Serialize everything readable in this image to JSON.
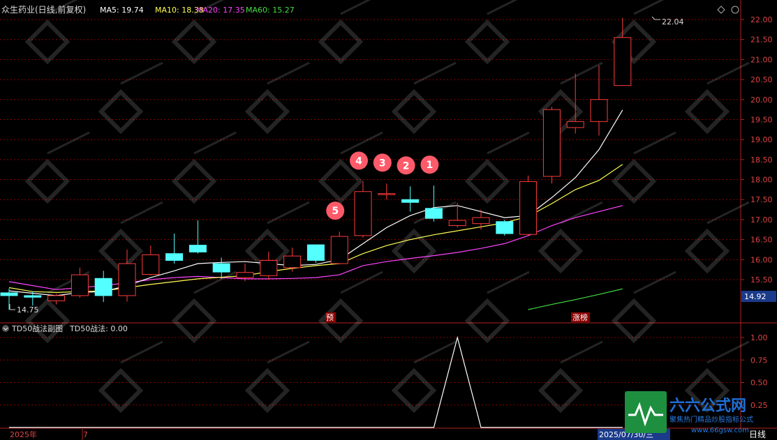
{
  "header": {
    "stock_title": "众生药业(日线,前复权)",
    "ma_items": [
      {
        "label": "MA5: 19.74",
        "color": "#ffffff"
      },
      {
        "label": "MA10: 18.38",
        "color": "#ffff55"
      },
      {
        "label": "MA20: 17.35",
        "color": "#ff44ff"
      },
      {
        "label": "MA60: 15.27",
        "color": "#44dd44"
      }
    ],
    "diamond_icon": "diamond-icon",
    "circle_icon": "circle-icon"
  },
  "price_axis": {
    "ticks": [
      "22.00",
      "21.50",
      "21.00",
      "20.50",
      "20.00",
      "19.50",
      "19.00",
      "18.50",
      "18.00",
      "17.50",
      "17.00",
      "16.50",
      "16.00",
      "15.50"
    ],
    "current_price": "14.92"
  },
  "annotations": {
    "high_label": "22.04",
    "low_label": "14.75",
    "pre_marker": "预",
    "limit_up_marker": "涨榜",
    "numbered_circles": [
      "5",
      "4",
      "3",
      "2",
      "1"
    ]
  },
  "sub_chart": {
    "title": "TD50战法副图",
    "value_label": "TD50战法: 0.00",
    "ticks": [
      "1.00",
      "0.75",
      "0.50",
      "0.25"
    ]
  },
  "bottom_bar": {
    "year_label": "2025年",
    "month_label": "7",
    "date_label": "2025/07/30/三",
    "period_label": "日线"
  },
  "watermark": {
    "brand": "六六公式网",
    "slogan": "聚焦热门精品炒股指标公式",
    "url": "www.66gsw.com"
  },
  "colors": {
    "up": "#ff3b3b",
    "down": "#54ffff",
    "ma5": "#ffffff",
    "ma10": "#ffff55",
    "ma20": "#ff44ff",
    "ma60": "#44dd44",
    "grid": "#8b0000"
  },
  "chart_data": {
    "type": "candlestick",
    "candles": [
      {
        "o": 15.17,
        "h": 15.28,
        "l": 14.75,
        "c": 15.1
      },
      {
        "o": 15.1,
        "h": 15.21,
        "l": 14.85,
        "c": 15.06
      },
      {
        "o": 14.97,
        "h": 15.15,
        "l": 14.88,
        "c": 15.1
      },
      {
        "o": 15.1,
        "h": 15.8,
        "l": 15.05,
        "c": 15.62
      },
      {
        "o": 15.53,
        "h": 15.72,
        "l": 14.94,
        "c": 15.1
      },
      {
        "o": 15.1,
        "h": 16.25,
        "l": 14.95,
        "c": 15.9
      },
      {
        "o": 15.63,
        "h": 16.35,
        "l": 15.6,
        "c": 16.12
      },
      {
        "o": 16.15,
        "h": 16.65,
        "l": 15.9,
        "c": 15.98
      },
      {
        "o": 16.36,
        "h": 16.98,
        "l": 16.15,
        "c": 16.19
      },
      {
        "o": 15.9,
        "h": 16.05,
        "l": 15.52,
        "c": 15.69
      },
      {
        "o": 15.55,
        "h": 15.9,
        "l": 15.46,
        "c": 15.68
      },
      {
        "o": 15.6,
        "h": 16.2,
        "l": 15.5,
        "c": 15.98
      },
      {
        "o": 15.8,
        "h": 16.3,
        "l": 15.7,
        "c": 16.09
      },
      {
        "o": 16.37,
        "h": 16.37,
        "l": 15.92,
        "c": 15.98
      },
      {
        "o": 15.9,
        "h": 16.7,
        "l": 15.88,
        "c": 16.58
      },
      {
        "o": 16.6,
        "h": 17.95,
        "l": 16.55,
        "c": 17.7
      },
      {
        "o": 17.65,
        "h": 17.9,
        "l": 17.5,
        "c": 17.65
      },
      {
        "o": 17.5,
        "h": 17.83,
        "l": 17.2,
        "c": 17.43
      },
      {
        "o": 17.28,
        "h": 17.85,
        "l": 16.95,
        "c": 17.03
      },
      {
        "o": 16.85,
        "h": 17.42,
        "l": 16.8,
        "c": 16.98
      },
      {
        "o": 16.9,
        "h": 17.25,
        "l": 16.75,
        "c": 17.05
      },
      {
        "o": 16.95,
        "h": 17.0,
        "l": 16.6,
        "c": 16.65
      },
      {
        "o": 16.63,
        "h": 18.1,
        "l": 16.6,
        "c": 17.95
      },
      {
        "o": 18.08,
        "h": 19.82,
        "l": 17.9,
        "c": 19.75
      },
      {
        "o": 19.3,
        "h": 20.65,
        "l": 19.15,
        "c": 19.45
      },
      {
        "o": 19.45,
        "h": 20.85,
        "l": 19.1,
        "c": 20.0
      },
      {
        "o": 20.35,
        "h": 22.04,
        "l": 20.35,
        "c": 21.55
      }
    ],
    "ma5": [
      15.22,
      15.16,
      15.1,
      15.18,
      15.2,
      15.35,
      15.55,
      15.72,
      15.9,
      15.93,
      15.95,
      15.9,
      15.85,
      15.88,
      16.0,
      16.4,
      16.8,
      17.1,
      17.3,
      17.35,
      17.2,
      17.05,
      17.1,
      17.55,
      18.05,
      18.75,
      19.74
    ],
    "ma10": [
      15.3,
      15.2,
      15.18,
      15.2,
      15.22,
      15.3,
      15.38,
      15.45,
      15.52,
      15.56,
      15.6,
      15.7,
      15.78,
      15.85,
      15.9,
      16.15,
      16.35,
      16.5,
      16.62,
      16.72,
      16.82,
      16.92,
      17.08,
      17.4,
      17.75,
      17.98,
      18.38
    ],
    "ma20": [
      15.45,
      15.35,
      15.25,
      15.3,
      15.35,
      15.42,
      15.5,
      15.55,
      15.58,
      15.55,
      15.52,
      15.52,
      15.53,
      15.55,
      15.62,
      15.85,
      15.95,
      16.03,
      16.1,
      16.18,
      16.28,
      16.4,
      16.6,
      16.85,
      17.05,
      17.2,
      17.35
    ],
    "ma60": [
      null,
      null,
      null,
      null,
      null,
      null,
      null,
      null,
      null,
      null,
      null,
      null,
      null,
      null,
      null,
      null,
      null,
      null,
      null,
      null,
      null,
      null,
      14.75,
      14.88,
      15.0,
      15.13,
      15.27
    ],
    "td50": [
      0,
      0,
      0,
      0,
      0,
      0,
      0,
      0,
      0,
      0,
      0,
      0,
      0,
      0,
      0,
      0,
      0,
      0,
      0,
      1,
      0,
      0,
      0,
      0,
      0,
      0,
      0
    ],
    "ylim": [
      15.25,
      22.25
    ],
    "sub_ylim": [
      0,
      1.0
    ]
  }
}
